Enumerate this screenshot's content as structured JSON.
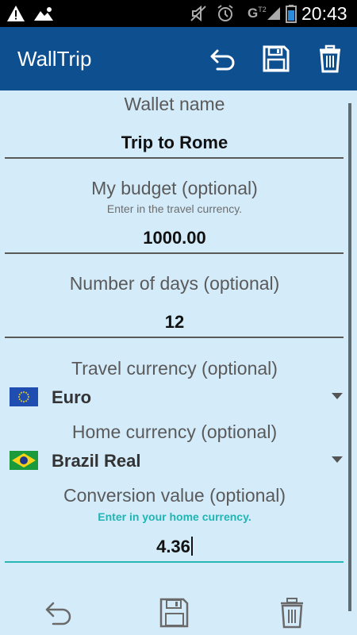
{
  "status_bar": {
    "time": "20:43",
    "network": "G",
    "network_sub": "T2"
  },
  "app_bar": {
    "title": "WallTrip"
  },
  "form": {
    "wallet_name": {
      "label": "Wallet name",
      "value": "Trip to Rome"
    },
    "budget": {
      "label": "My budget (optional)",
      "hint": "Enter in the travel currency.",
      "value": "1000.00"
    },
    "days": {
      "label": "Number of days (optional)",
      "value": "12"
    },
    "travel_currency": {
      "label": "Travel currency (optional)",
      "selected": "Euro",
      "flag_icon": "eu-flag-icon"
    },
    "home_currency": {
      "label": "Home currency (optional)",
      "selected": "Brazil Real",
      "flag_icon": "brazil-flag-icon"
    },
    "conversion": {
      "label": "Conversion value (optional)",
      "hint": "Enter in your home currency.",
      "value": "4.36"
    }
  },
  "colors": {
    "app_bar": "#0d4f8f",
    "background": "#d4ebfa",
    "accent": "#2ab5b5"
  },
  "icons": [
    "undo-icon",
    "save-icon",
    "trash-icon"
  ]
}
